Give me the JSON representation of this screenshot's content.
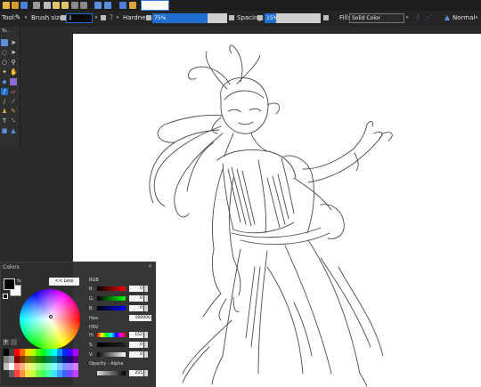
{
  "toolbar": {
    "tool_label": "Tool:",
    "brush_size_label": "Brush size:",
    "brush_size_value": "1",
    "hardness_label": "Hardness:",
    "hardness_value": "75%",
    "spacing_label": "Spacing:",
    "spacing_value": "15%",
    "fill_label": "Fill:",
    "fill_value": "Solid Color",
    "blend_mode": "Normal"
  },
  "tools_panel": {
    "title": "To..."
  },
  "colors_panel": {
    "title": "Colors",
    "less_button": "<< Less",
    "rgb_label": "RGB",
    "r_label": "R:",
    "r_value": "0",
    "g_label": "G:",
    "g_value": "0",
    "b_label": "B:",
    "b_value": "0",
    "hex_label": "Hex:",
    "hex_value": "000000",
    "hsv_label": "HSV",
    "h_label": "H:",
    "h_value": "152",
    "s_label": "S:",
    "s_value": "0",
    "v_label": "V:",
    "v_value": "0",
    "opacity_label": "Opacity - Alpha",
    "alpha_value": "255",
    "close_icon": "×",
    "primary_color": "#000000",
    "secondary_color": "#ffffff"
  },
  "colors": {
    "accent_blue": "#1f6fd0",
    "panel_bg": "#2e2e2e",
    "canvas_bg": "#ffffff"
  }
}
